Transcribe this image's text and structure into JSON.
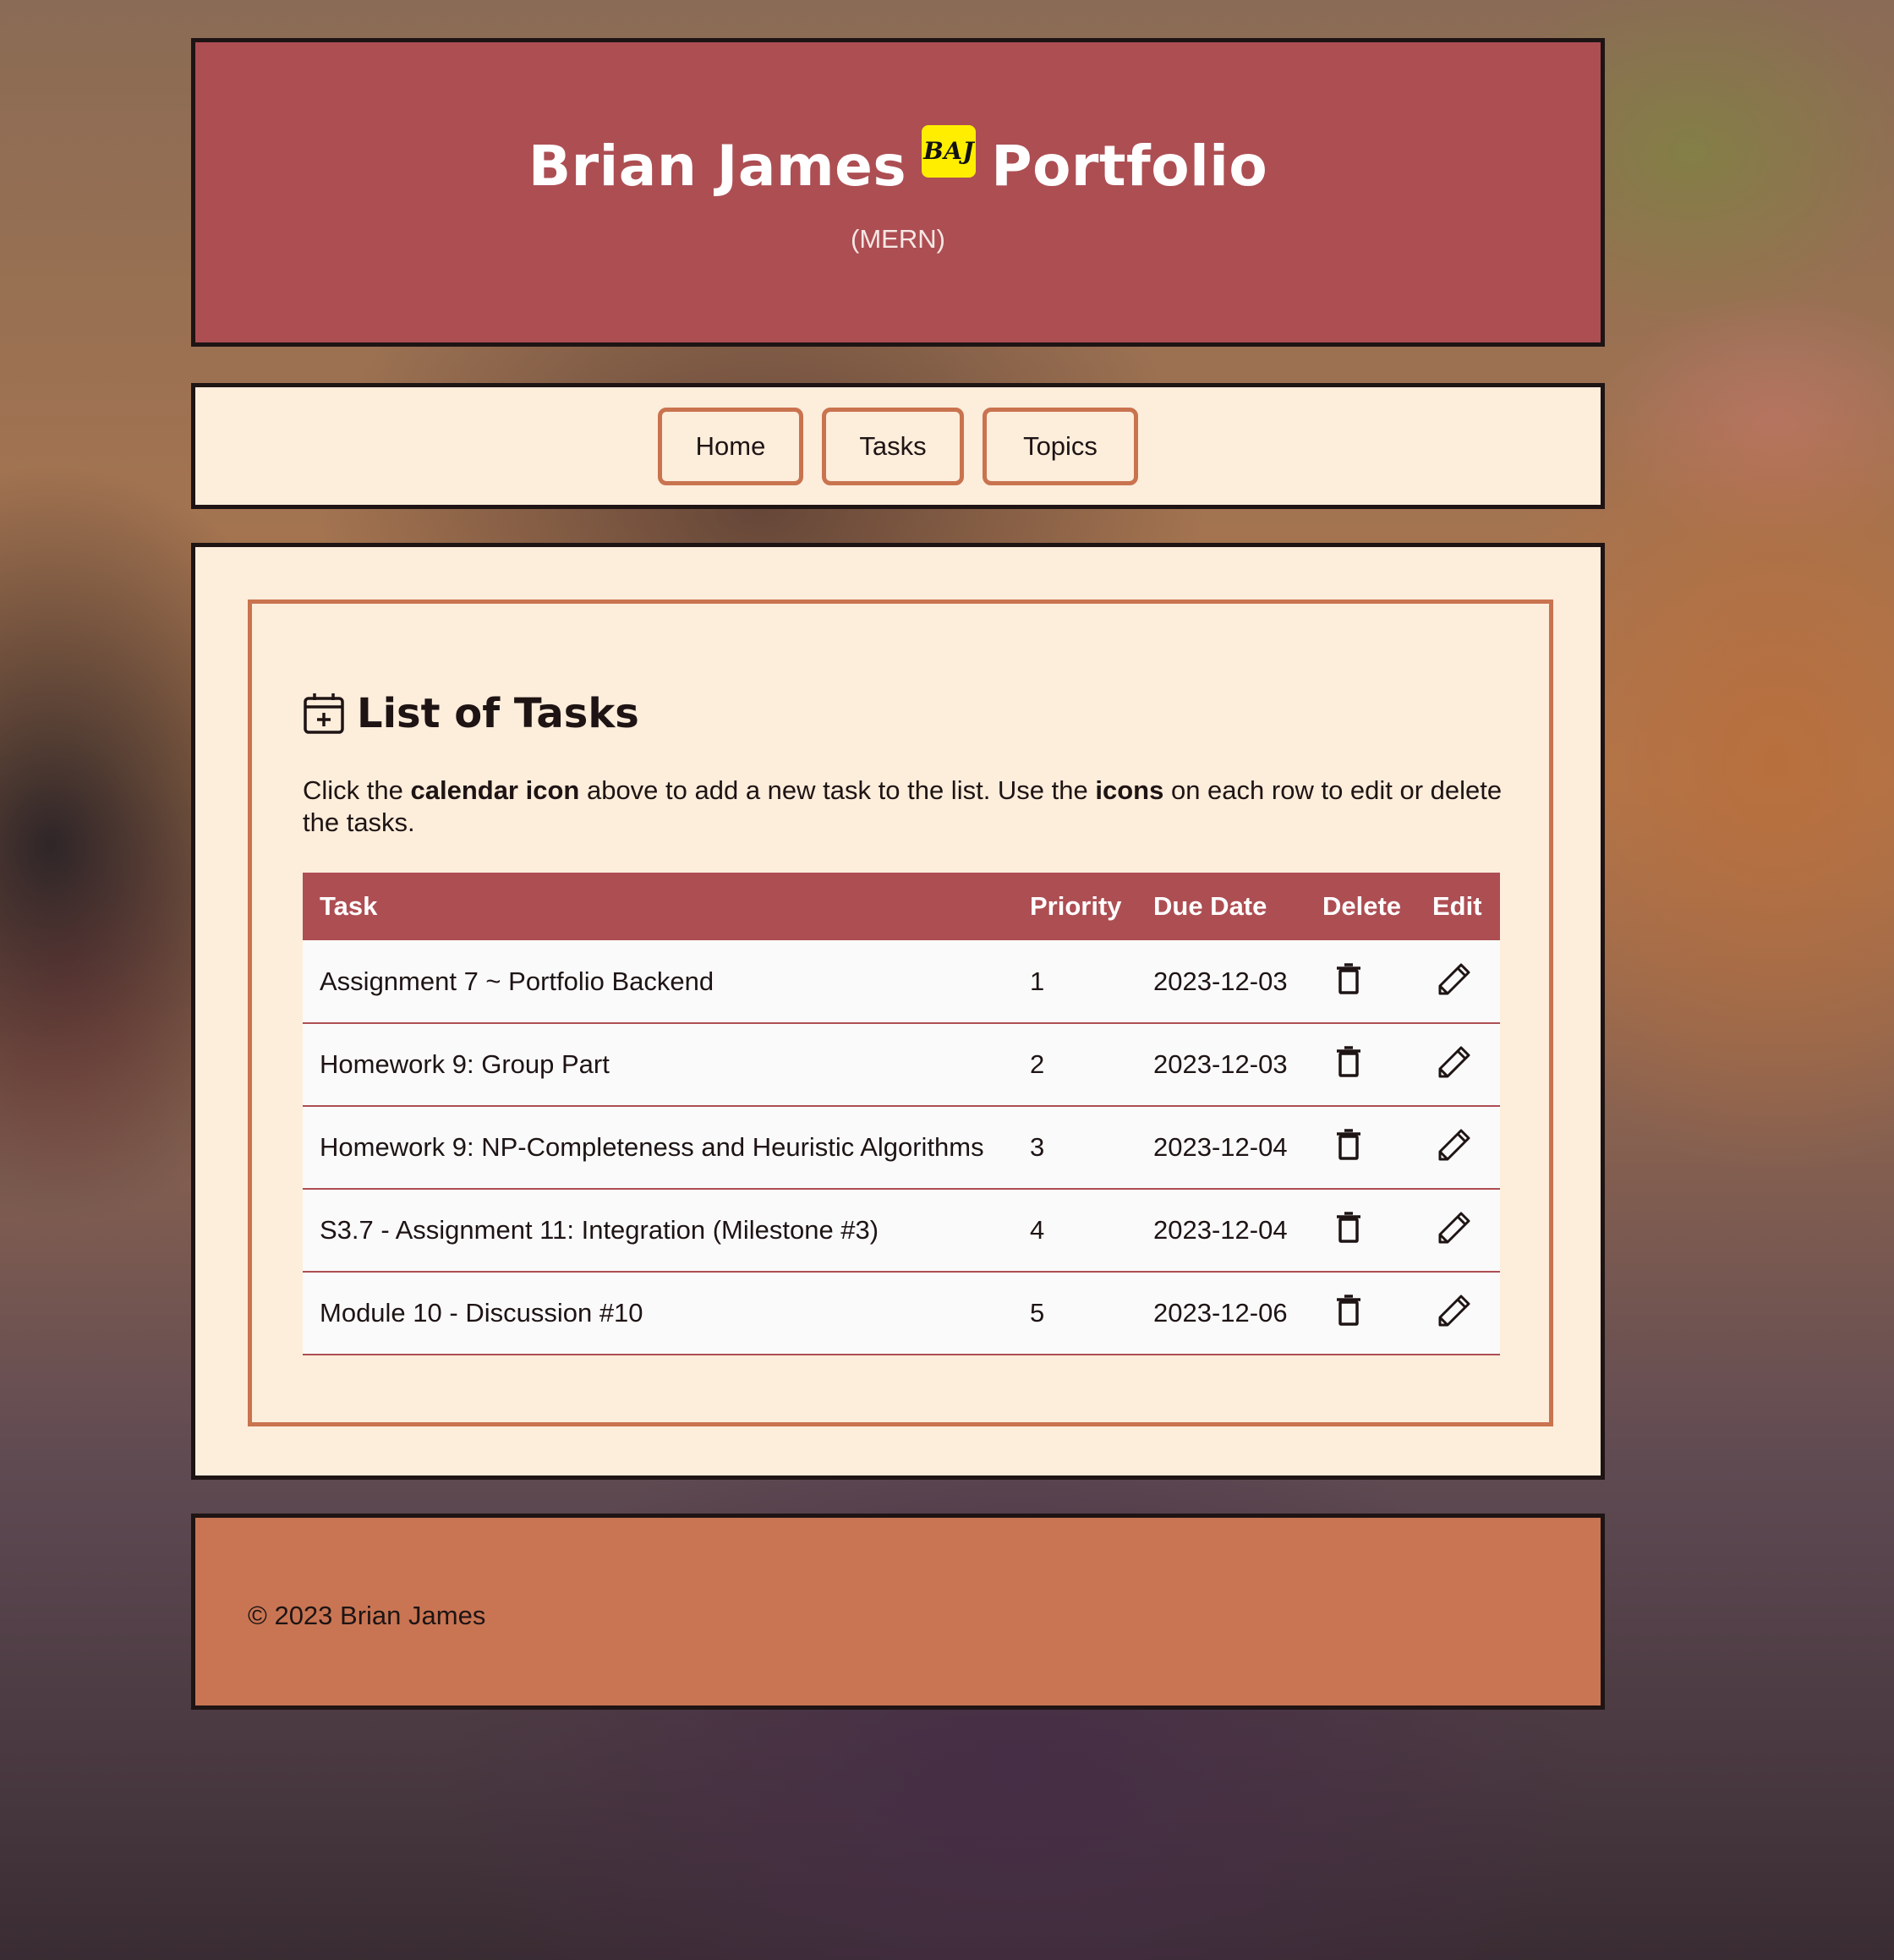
{
  "header": {
    "title_left": "Brian James",
    "badge": "BAJ",
    "title_right": "Portfolio",
    "subtitle": "(MERN)"
  },
  "nav": {
    "home": "Home",
    "tasks": "Tasks",
    "topics": "Topics"
  },
  "main": {
    "title": "List of Tasks",
    "intro": {
      "part1": "Click the ",
      "bold1": "calendar icon",
      "part2": " above to add a new task to the list. Use the ",
      "bold2": "icons",
      "part3": " on each row to edit or delete the tasks."
    },
    "table": {
      "headers": {
        "task": "Task",
        "priority": "Priority",
        "due_date": "Due Date",
        "delete": "Delete",
        "edit": "Edit"
      },
      "rows": [
        {
          "task": "Assignment 7 ~ Portfolio Backend",
          "priority": "1",
          "due": "2023-12-03"
        },
        {
          "task": "Homework 9: Group Part",
          "priority": "2",
          "due": "2023-12-03"
        },
        {
          "task": "Homework 9: NP-Completeness and Heuristic Algorithms",
          "priority": "3",
          "due": "2023-12-04"
        },
        {
          "task": "S3.7 - Assignment 11: Integration (Milestone #3)",
          "priority": "4",
          "due": "2023-12-04"
        },
        {
          "task": "Module 10 - Discussion #10",
          "priority": "5",
          "due": "2023-12-06"
        }
      ]
    }
  },
  "footer": {
    "copyright": "© 2023 Brian James"
  }
}
